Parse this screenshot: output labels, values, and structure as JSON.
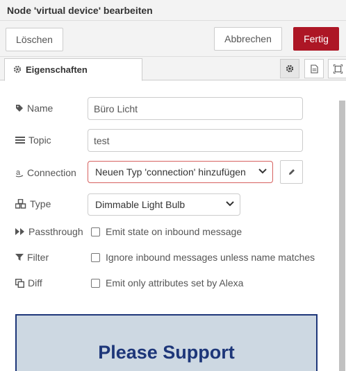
{
  "dialog": {
    "title": "Node 'virtual device' bearbeiten"
  },
  "buttons": {
    "delete": "Löschen",
    "cancel": "Abbrechen",
    "done": "Fertig"
  },
  "tabs": {
    "properties": "Eigenschaften"
  },
  "fields": {
    "name": {
      "label": "Name",
      "value": "Büro Licht"
    },
    "topic": {
      "label": "Topic",
      "value": "test"
    },
    "connection": {
      "label": "Connection",
      "value": "Neuen Typ 'connection' hinzufügen"
    },
    "type": {
      "label": "Type",
      "value": "Dimmable Light Bulb"
    },
    "passthrough": {
      "label": "Passthrough",
      "text": "Emit state on inbound message",
      "checked": false
    },
    "filter": {
      "label": "Filter",
      "text": "Ignore inbound messages unless name matches",
      "checked": false
    },
    "diff": {
      "label": "Diff",
      "text": "Emit only attributes set by Alexa",
      "checked": false
    }
  },
  "support": {
    "text": "Please Support"
  },
  "colors": {
    "accent": "#ad1625",
    "support_bg": "#cdd8e2",
    "support_text": "#1d3679",
    "error_border": "#d6615f"
  },
  "icons": [
    "gear-icon",
    "document-icon",
    "frame-icon",
    "tag-icon",
    "list-icon",
    "amazon-icon",
    "cubes-icon",
    "fast-forward-icon",
    "filter-icon",
    "copy-icon",
    "pencil-icon",
    "chevron-down-icon"
  ]
}
